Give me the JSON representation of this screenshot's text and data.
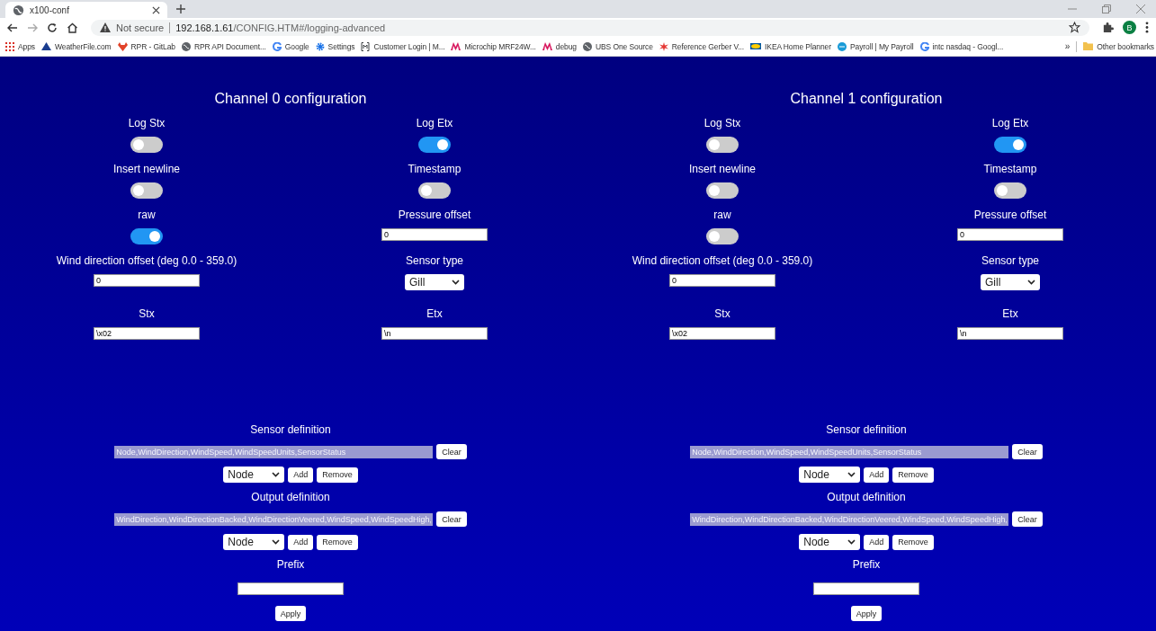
{
  "browser": {
    "tab_title": "x100-conf",
    "security": "Not secure",
    "url_host": "192.168.1.61",
    "url_path": "/CONFIG.HTM#/logging-advanced",
    "profile": "B",
    "bookmarks": [
      {
        "label": "Apps",
        "kind": "apps"
      },
      {
        "label": "WeatherFile.com",
        "kind": "triangle"
      },
      {
        "label": "RPR - GitLab",
        "kind": "fox"
      },
      {
        "label": "RPR API Document...",
        "kind": "globe"
      },
      {
        "label": "Google",
        "kind": "g"
      },
      {
        "label": "Settings",
        "kind": "gear"
      },
      {
        "label": "Customer Login | M...",
        "kind": "bracket"
      },
      {
        "label": "Microchip MRF24W...",
        "kind": "chip"
      },
      {
        "label": "debug",
        "kind": "chip"
      },
      {
        "label": "UBS One Source",
        "kind": "globe"
      },
      {
        "label": "Reference Gerber V...",
        "kind": "star"
      },
      {
        "label": "IKEA Home Planner",
        "kind": "ikea"
      },
      {
        "label": "Payroll | My Payroll",
        "kind": "dot"
      },
      {
        "label": "intc nasdaq - Googl...",
        "kind": "g"
      }
    ],
    "more": "»",
    "other_bookmarks": "Other bookmarks"
  },
  "channels": [
    {
      "title": "Channel 0 configuration",
      "fields": [
        {
          "label": "Log Stx",
          "kind": "toggle",
          "on": false
        },
        {
          "label": "Log Etx",
          "kind": "toggle",
          "on": true
        },
        {
          "label": "Insert newline",
          "kind": "toggle",
          "on": false
        },
        {
          "label": "Timestamp",
          "kind": "toggle",
          "on": false
        },
        {
          "label": "raw",
          "kind": "toggle",
          "on": true
        },
        {
          "label": "Pressure offset",
          "kind": "text",
          "value": "0"
        },
        {
          "label": "Wind direction offset (deg 0.0 - 359.0)",
          "kind": "text",
          "value": "0"
        },
        {
          "label": "Sensor type",
          "kind": "select",
          "value": "Gill"
        },
        {
          "label": "Stx",
          "kind": "text",
          "value": "\\x02"
        },
        {
          "label": "Etx",
          "kind": "text",
          "value": "\\n"
        }
      ],
      "definitions": [
        {
          "label": "Sensor definition",
          "value": "Node,WindDirection,WindSpeed,WindSpeedUnits,SensorStatus",
          "clear": "Clear",
          "select": "Node",
          "add": "Add",
          "remove": "Remove"
        },
        {
          "label": "Output definition",
          "value": "WindDirection,WindDirectionBacked,WindDirectionVeered,WindSpeed,WindSpeedHigh,",
          "clear": "Clear",
          "select": "Node",
          "add": "Add",
          "remove": "Remove"
        }
      ],
      "prefix_label": "Prefix",
      "apply": "Apply"
    },
    {
      "title": "Channel 1 configuration",
      "fields": [
        {
          "label": "Log Stx",
          "kind": "toggle",
          "on": false
        },
        {
          "label": "Log Etx",
          "kind": "toggle",
          "on": true
        },
        {
          "label": "Insert newline",
          "kind": "toggle",
          "on": false
        },
        {
          "label": "Timestamp",
          "kind": "toggle",
          "on": false
        },
        {
          "label": "raw",
          "kind": "toggle",
          "on": false
        },
        {
          "label": "Pressure offset",
          "kind": "text",
          "value": "0"
        },
        {
          "label": "Wind direction offset (deg 0.0 - 359.0)",
          "kind": "text",
          "value": "0"
        },
        {
          "label": "Sensor type",
          "kind": "select",
          "value": "Gill"
        },
        {
          "label": "Stx",
          "kind": "text",
          "value": "\\x02"
        },
        {
          "label": "Etx",
          "kind": "text",
          "value": "\\n"
        }
      ],
      "definitions": [
        {
          "label": "Sensor definition",
          "value": "Node,WindDirection,WindSpeed,WindSpeedUnits,SensorStatus",
          "clear": "Clear",
          "select": "Node",
          "add": "Add",
          "remove": "Remove"
        },
        {
          "label": "Output definition",
          "value": "WindDirection,WindDirectionBacked,WindDirectionVeered,WindSpeed,WindSpeedHigh,",
          "clear": "Clear",
          "select": "Node",
          "add": "Add",
          "remove": "Remove"
        }
      ],
      "prefix_label": "Prefix",
      "apply": "Apply"
    }
  ]
}
